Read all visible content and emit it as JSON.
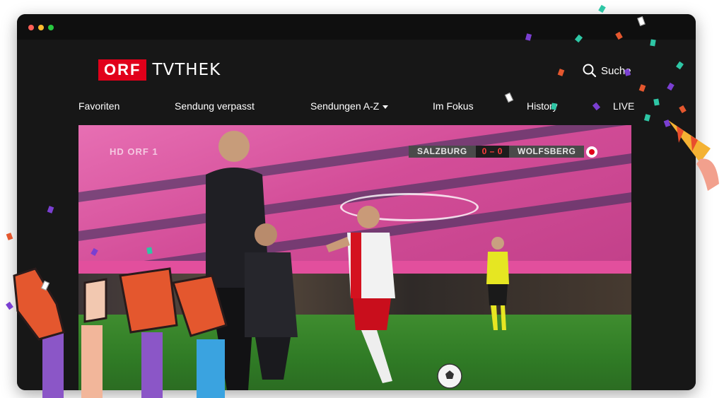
{
  "logo": {
    "orf": "ORF",
    "tvthek": "TVTHEK"
  },
  "search": {
    "label": "Suche",
    "icon": "search-icon"
  },
  "nav": [
    {
      "label": "Favoriten"
    },
    {
      "label": "Sendung verpasst"
    },
    {
      "label": "Sendungen A-Z",
      "dropdown": true
    },
    {
      "label": "Im Fokus"
    },
    {
      "label": "History"
    },
    {
      "label": "LIVE"
    }
  ],
  "video": {
    "channel_logo": "HD ORF 1",
    "scoreboard": {
      "home": "SALZBURG",
      "score": "0 – 0",
      "away": "WOLFSBERG"
    }
  },
  "colors": {
    "brand_red": "#e1001a",
    "background": "#171717",
    "stand_pink": "#d95aa2",
    "pitch_green": "#2f7a25"
  }
}
